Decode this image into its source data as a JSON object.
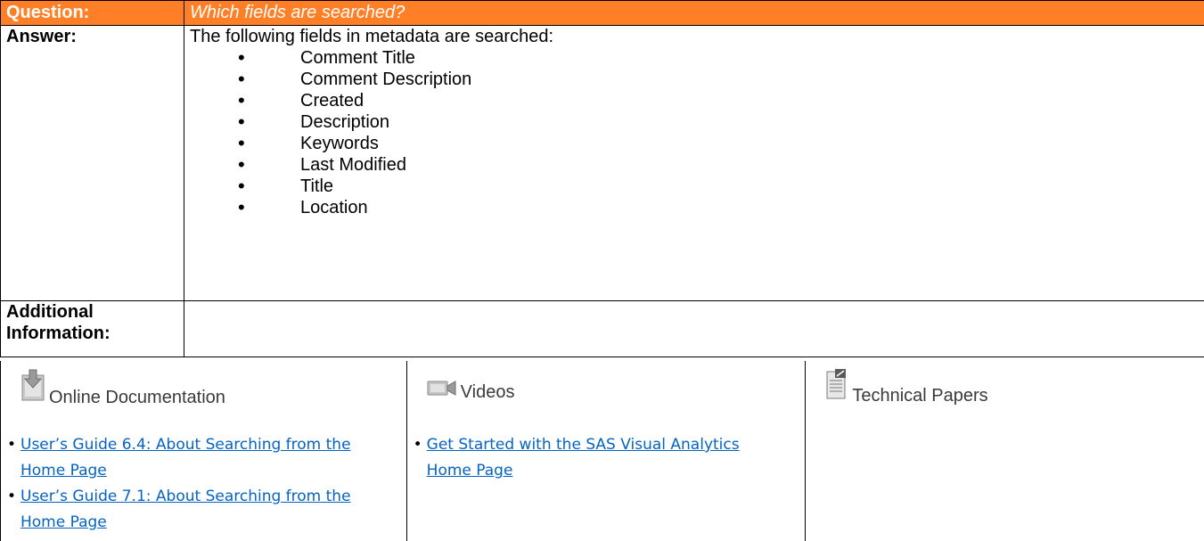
{
  "question": {
    "label": "Question:",
    "text": "Which fields are searched?"
  },
  "answer": {
    "label": "Answer:",
    "intro": "The following fields in metadata are searched:",
    "fields": [
      "Comment Title",
      "Comment Description",
      "Created",
      "Description",
      "Keywords",
      "Last Modified",
      "Title",
      "Location"
    ]
  },
  "additional": {
    "label_line1": "Additional",
    "label_line2": "Information:",
    "content": ""
  },
  "resources": {
    "online_documentation": {
      "title": "Online Documentation",
      "icon": "download-document-icon",
      "links": [
        "User’s Guide 6.4: About Searching from the Home Page",
        "User’s Guide 7.1: About Searching from the Home Page"
      ]
    },
    "videos": {
      "title": "Videos",
      "icon": "video-camera-icon",
      "links": [
        "Get Started with the SAS Visual Analytics Home Page"
      ]
    },
    "technical_papers": {
      "title": "Technical Papers",
      "icon": "paper-document-icon",
      "links": []
    }
  },
  "colors": {
    "header_orange": "#ff7f27",
    "link_blue": "#0563c1"
  }
}
